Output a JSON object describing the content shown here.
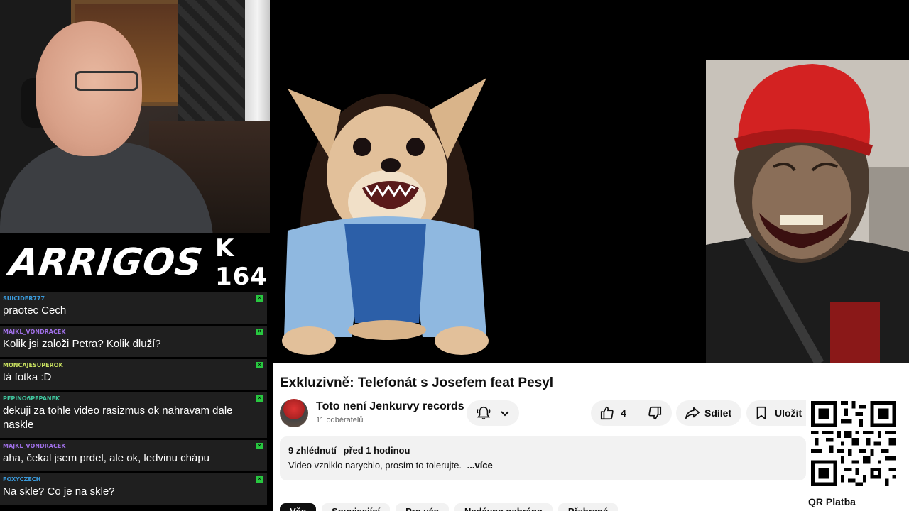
{
  "stream": {
    "logo_title": "ARRIGOS",
    "episode": "K 164"
  },
  "chat": {
    "messages": [
      {
        "user": "SUICIDER777",
        "text": "praotec Cech",
        "color": "#3a9bdc"
      },
      {
        "user": "MAJKL_VONDRACEK",
        "text": "Kolik jsi založi Petra? Kolik dluží?",
        "color": "#a070e8"
      },
      {
        "user": "MONCAJESUPEROK",
        "text": "tá fotka :D",
        "color": "#c8e060"
      },
      {
        "user": "PEPINO6PEPANEK",
        "text": "dekuji za tohle video rasizmus ok nahravam dale naskle",
        "color": "#40c8a0"
      },
      {
        "user": "MAJKL_VONDRACEK",
        "text": "aha, čekal jsem prdel, ale ok, ledvinu chápu",
        "color": "#a070e8"
      },
      {
        "user": "FOXYCZECH",
        "text": "Na skle? Co je na skle?",
        "color": "#3a9bdc"
      }
    ],
    "badge_icon": "moderator-badge-icon",
    "badge_color": "#28c840"
  },
  "video": {
    "left_image": "angry-chihuahua-with-wig-and-denim-shirt",
    "right_image": "laughing-chimpanzee-with-red-cap"
  },
  "youtube": {
    "title": "Exkluzivně: Telefonát s Josefem feat Pesyl",
    "channel_name": "Toto není Jenkurvy records",
    "subscribers": "11 odběratelů",
    "likes": "4",
    "share_label": "Sdílet",
    "save_label": "Uložit",
    "views": "9 zhlédnutí",
    "time_ago": "před 1 hodinou",
    "description": "Video vzniklo narychlo, prosím to tolerujte.",
    "more_label": "...více",
    "chips": [
      "Vše",
      "Související",
      "Pro vás",
      "Nedávno nahráno",
      "Přehrané"
    ]
  },
  "qr": {
    "label": "QR Platba"
  }
}
